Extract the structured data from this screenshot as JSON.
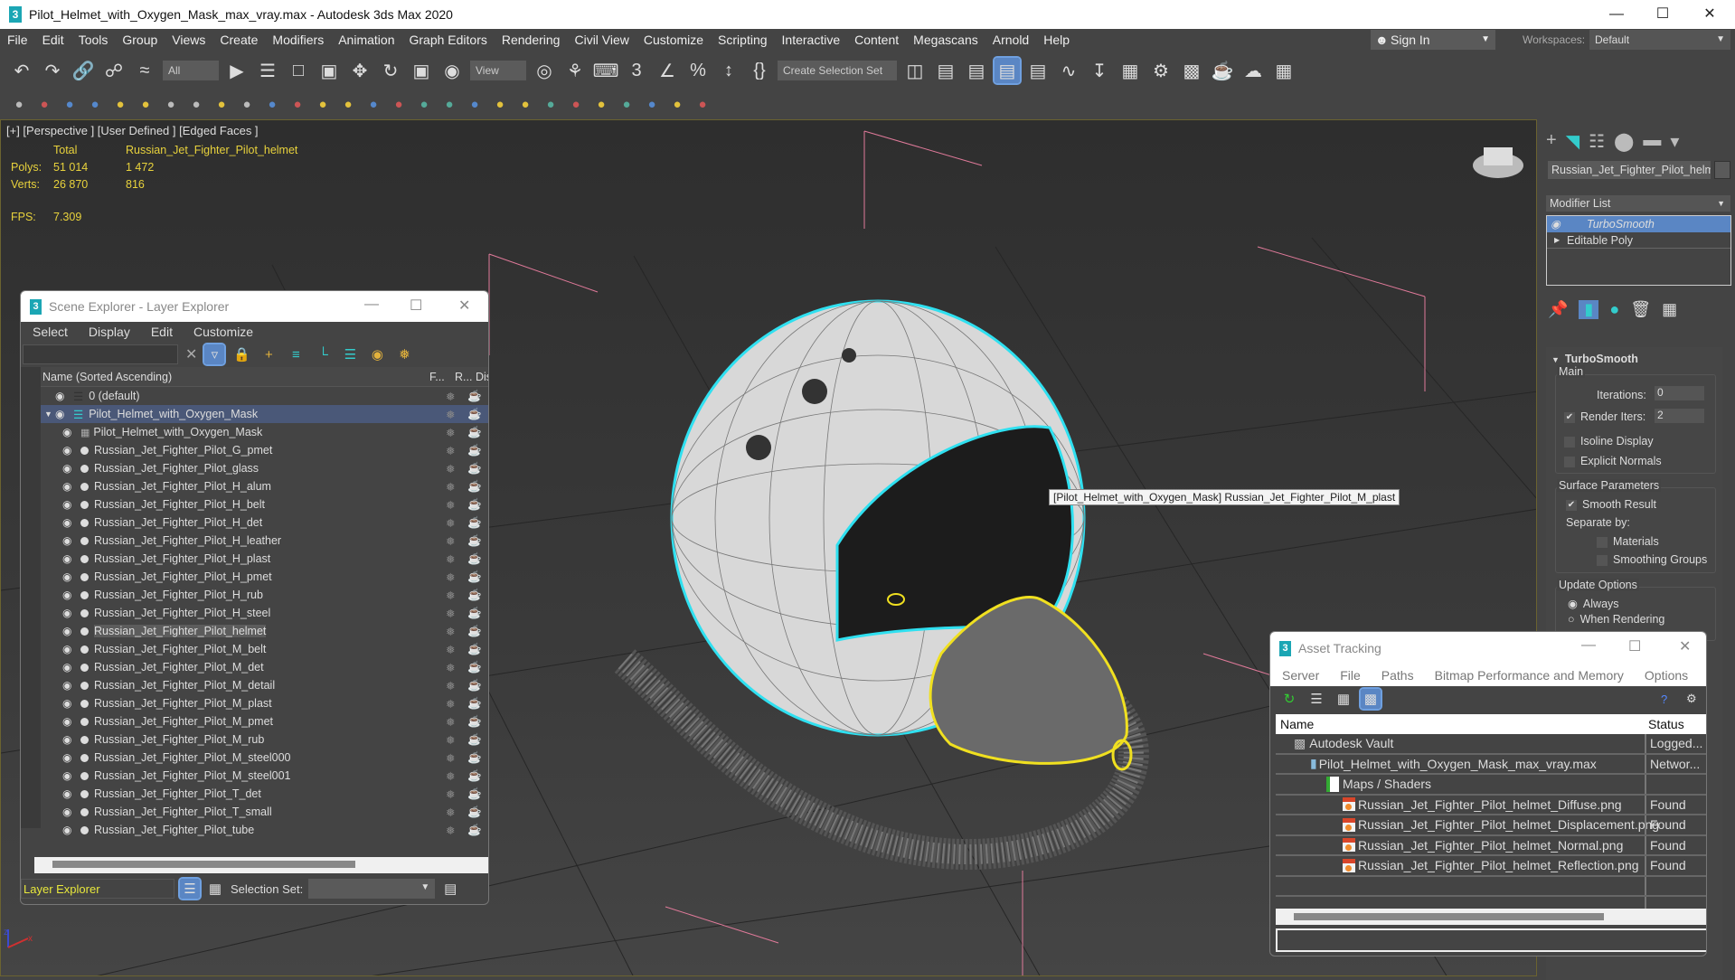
{
  "window": {
    "title": "Pilot_Helmet_with_Oxygen_Mask_max_vray.max - Autodesk 3ds Max 2020",
    "app_icon": "3"
  },
  "menu": [
    "File",
    "Edit",
    "Tools",
    "Group",
    "Views",
    "Create",
    "Modifiers",
    "Animation",
    "Graph Editors",
    "Rendering",
    "Civil View",
    "Customize",
    "Scripting",
    "Interactive",
    "Content",
    "Megascans",
    "Arnold",
    "Help"
  ],
  "account": {
    "sign_in": "Sign In",
    "workspaces_label": "Workspaces:",
    "workspace": "Default"
  },
  "toolbar": {
    "filter": "All",
    "ref_coord": "View",
    "selection_set": "Create Selection Set"
  },
  "toolbar1_icons": [
    "undo-icon",
    "redo-icon",
    "link-icon",
    "unlink-icon",
    "bind-space-warp-icon",
    "select-object-icon",
    "select-by-name-icon",
    "rect-selection-icon",
    "window-crossing-icon",
    "move-icon",
    "rotate-icon",
    "scale-icon",
    "placement-icon",
    "pivot-icon",
    "manipulate-icon",
    "keyboard-shortcut-icon",
    "snap-3d-icon",
    "angle-snap-icon",
    "percent-snap-icon",
    "spinner-snap-icon",
    "edit-named-sel-icon",
    "mirror-icon",
    "align-icon",
    "scene-explorer-icon",
    "layer-explorer-icon",
    "ribbon-icon",
    "curve-editor-icon",
    "dope-sheet-icon",
    "material-editor-icon",
    "render-setup-icon",
    "rendered-frame-icon",
    "render-icon",
    "render-cloud-icon",
    "a360-icon"
  ],
  "toolbar2_icons": [
    "teapot-icon",
    "cone-icon",
    "box-icon",
    "cylinder-icon",
    "plane-icon",
    "light-icon",
    "camera-icon",
    "helper-icon",
    "space-warp-icon",
    "sphere-icon",
    "egg-icon",
    "geosphere-icon",
    "torus-icon",
    "cone2-icon",
    "sun-icon",
    "omni-icon",
    "checker-icon",
    "capsule-icon",
    "particle-icon",
    "globe-icon",
    "plant-icon",
    "feather-icon",
    "rock-icon",
    "material-sphere-icon",
    "texture-icon",
    "material-icon",
    "chart-icon",
    "help-icon"
  ],
  "viewport": {
    "label": "[+] [Perspective ] [User Defined ] [Edged Faces ]",
    "stats": {
      "total_label": "Total",
      "object_label": "Russian_Jet_Fighter_Pilot_helmet",
      "polys_label": "Polys:",
      "polys_total": "51 014",
      "polys_obj": "1 472",
      "verts_label": "Verts:",
      "verts_total": "26 870",
      "verts_obj": "816",
      "fps_label": "FPS:",
      "fps": "7.309"
    },
    "tooltip": "[Pilot_Helmet_with_Oxygen_Mask] Russian_Jet_Fighter_Pilot_M_plast",
    "axis_z": "z",
    "axis_x": "x"
  },
  "scene_explorer": {
    "title": "Scene Explorer - Layer Explorer",
    "menu": [
      "Select",
      "Display",
      "Edit",
      "Customize"
    ],
    "columns": {
      "name": "Name (Sorted Ascending)",
      "frozen": "F...",
      "render": "R...",
      "display": "Disp"
    },
    "rows": [
      {
        "name": "0 (default)",
        "level": 0,
        "type": "layer"
      },
      {
        "name": "Pilot_Helmet_with_Oxygen_Mask",
        "level": 0,
        "type": "layer",
        "expanded": true,
        "selected": true
      },
      {
        "name": "Pilot_Helmet_with_Oxygen_Mask",
        "level": 1,
        "type": "group"
      },
      {
        "name": "Russian_Jet_Fighter_Pilot_G_pmet",
        "level": 1
      },
      {
        "name": "Russian_Jet_Fighter_Pilot_glass",
        "level": 1
      },
      {
        "name": "Russian_Jet_Fighter_Pilot_H_alum",
        "level": 1
      },
      {
        "name": "Russian_Jet_Fighter_Pilot_H_belt",
        "level": 1
      },
      {
        "name": "Russian_Jet_Fighter_Pilot_H_det",
        "level": 1
      },
      {
        "name": "Russian_Jet_Fighter_Pilot_H_leather",
        "level": 1
      },
      {
        "name": "Russian_Jet_Fighter_Pilot_H_plast",
        "level": 1
      },
      {
        "name": "Russian_Jet_Fighter_Pilot_H_pmet",
        "level": 1
      },
      {
        "name": "Russian_Jet_Fighter_Pilot_H_rub",
        "level": 1
      },
      {
        "name": "Russian_Jet_Fighter_Pilot_H_steel",
        "level": 1
      },
      {
        "name": "Russian_Jet_Fighter_Pilot_helmet",
        "level": 1,
        "highlighted": true
      },
      {
        "name": "Russian_Jet_Fighter_Pilot_M_belt",
        "level": 1
      },
      {
        "name": "Russian_Jet_Fighter_Pilot_M_det",
        "level": 1
      },
      {
        "name": "Russian_Jet_Fighter_Pilot_M_detail",
        "level": 1
      },
      {
        "name": "Russian_Jet_Fighter_Pilot_M_plast",
        "level": 1
      },
      {
        "name": "Russian_Jet_Fighter_Pilot_M_pmet",
        "level": 1
      },
      {
        "name": "Russian_Jet_Fighter_Pilot_M_rub",
        "level": 1
      },
      {
        "name": "Russian_Jet_Fighter_Pilot_M_steel000",
        "level": 1
      },
      {
        "name": "Russian_Jet_Fighter_Pilot_M_steel001",
        "level": 1
      },
      {
        "name": "Russian_Jet_Fighter_Pilot_T_det",
        "level": 1
      },
      {
        "name": "Russian_Jet_Fighter_Pilot_T_small",
        "level": 1
      },
      {
        "name": "Russian_Jet_Fighter_Pilot_tube",
        "level": 1
      }
    ],
    "explorer_type": "Layer Explorer",
    "selection_set_label": "Selection Set:"
  },
  "command_panel": {
    "object_name": "Russian_Jet_Fighter_Pilot_helm",
    "modifier_list": "Modifier List",
    "stack": [
      "TurboSmooth",
      "Editable Poly"
    ],
    "rollout": "TurboSmooth",
    "main": "Main",
    "iterations_label": "Iterations:",
    "iterations": "0",
    "render_iters_label": "Render Iters:",
    "render_iters": "2",
    "render_iters_checked": true,
    "isoline": "Isoline Display",
    "explicit_normals": "Explicit Normals",
    "surface_params": "Surface Parameters",
    "smooth_result": "Smooth Result",
    "separate_by": "Separate by:",
    "materials": "Materials",
    "smoothing_groups": "Smoothing Groups",
    "update_options": "Update Options",
    "always": "Always",
    "when_rendering": "When Rendering"
  },
  "asset_tracking": {
    "title": "Asset Tracking",
    "menu": [
      "Server",
      "File",
      "Paths",
      "Bitmap Performance and Memory",
      "Options"
    ],
    "columns": {
      "name": "Name",
      "status": "Status"
    },
    "rows": [
      {
        "name": "Autodesk Vault",
        "status": "Logged...",
        "level": 0,
        "icon": "vault-icon"
      },
      {
        "name": "Pilot_Helmet_with_Oxygen_Mask_max_vray.max",
        "status": "Networ...",
        "level": 1,
        "icon": "max-file-icon"
      },
      {
        "name": "Maps / Shaders",
        "status": "",
        "level": 2,
        "icon": "maps-icon"
      },
      {
        "name": "Russian_Jet_Fighter_Pilot_helmet_Diffuse.png",
        "status": "Found",
        "level": 3,
        "icon": "png-icon"
      },
      {
        "name": "Russian_Jet_Fighter_Pilot_helmet_Displacement.png",
        "status": "Found",
        "level": 3,
        "icon": "png-icon"
      },
      {
        "name": "Russian_Jet_Fighter_Pilot_helmet_Normal.png",
        "status": "Found",
        "level": 3,
        "icon": "png-icon"
      },
      {
        "name": "Russian_Jet_Fighter_Pilot_helmet_Reflection.png",
        "status": "Found",
        "level": 3,
        "icon": "png-icon"
      }
    ]
  },
  "colors": {
    "accent": "#5a86c4",
    "stats_yellow": "#e8d23c",
    "selection_cyan": "#2fe0f0",
    "selection_yellow": "#f0e020"
  }
}
